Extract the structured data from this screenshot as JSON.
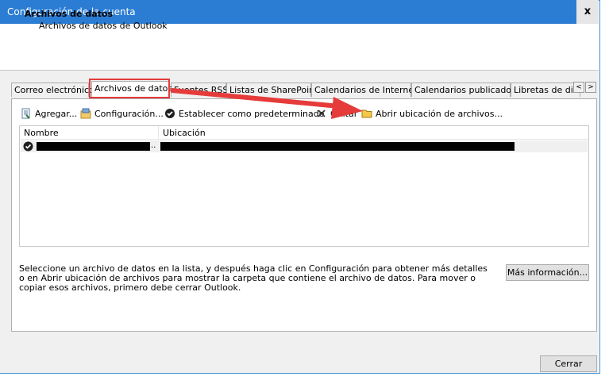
{
  "window": {
    "title": "Configuración de la cuenta",
    "close_label": "x"
  },
  "header": {
    "title": "Archivos de datos",
    "subtitle": "Archivos de datos de Outlook"
  },
  "tabs": [
    {
      "label": "Correo electrónico"
    },
    {
      "label": "Archivos de datos"
    },
    {
      "label": "Fuentes RSS"
    },
    {
      "label": "Listas de SharePoint"
    },
    {
      "label": "Calendarios de Internet"
    },
    {
      "label": "Calendarios publicados"
    },
    {
      "label": "Libretas de dire"
    }
  ],
  "tab_scroll": {
    "left": "<",
    "right": ">"
  },
  "toolbar": {
    "add": "Agregar...",
    "settings": "Configuración...",
    "set_default": "Establecer como predeterminado",
    "remove": "Quitar",
    "open_location": "Abrir ubicación de archivos..."
  },
  "list": {
    "columns": {
      "name": "Nombre",
      "location": "Ubicación"
    },
    "rows": [
      {
        "name": "[redacted]",
        "ellipsis": "..",
        "location": "[redacted]"
      }
    ]
  },
  "description": "Seleccione un archivo de datos en la lista, y después haga clic en Configuración para obtener más detalles o en Abrir ubicación de archivos para mostrar la carpeta que contiene el archivo de datos. Para mover o copiar esos archivos, primero debe cerrar Outlook.",
  "buttons": {
    "more_info": "Más información...",
    "close": "Cerrar"
  },
  "annotation": {
    "highlight_color": "#e53b3b",
    "arrow_color": "#e53b3b"
  },
  "colors": {
    "titlebar": "#2b7cd3",
    "window_bg": "#f0f0f0"
  }
}
